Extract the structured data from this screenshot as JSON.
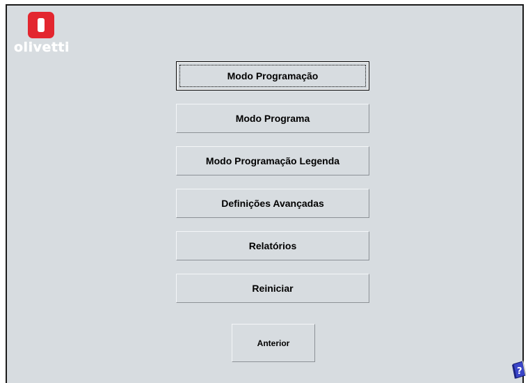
{
  "logo": {
    "brand_text": "olivetti",
    "badge_color": "#e3262f"
  },
  "menu": {
    "items": [
      {
        "label": "Modo Programação",
        "selected": true
      },
      {
        "label": "Modo Programa",
        "selected": false
      },
      {
        "label": "Modo Programação Legenda",
        "selected": false
      },
      {
        "label": "Definições Avançadas",
        "selected": false
      },
      {
        "label": "Relatórios",
        "selected": false
      },
      {
        "label": "Reiniciar",
        "selected": false
      }
    ]
  },
  "back_button": {
    "label": "Anterior"
  },
  "help": {
    "icon": "help-book-icon"
  },
  "colors": {
    "background": "#d7dce0",
    "frame": "#1a1a1a",
    "text": "#000000"
  }
}
